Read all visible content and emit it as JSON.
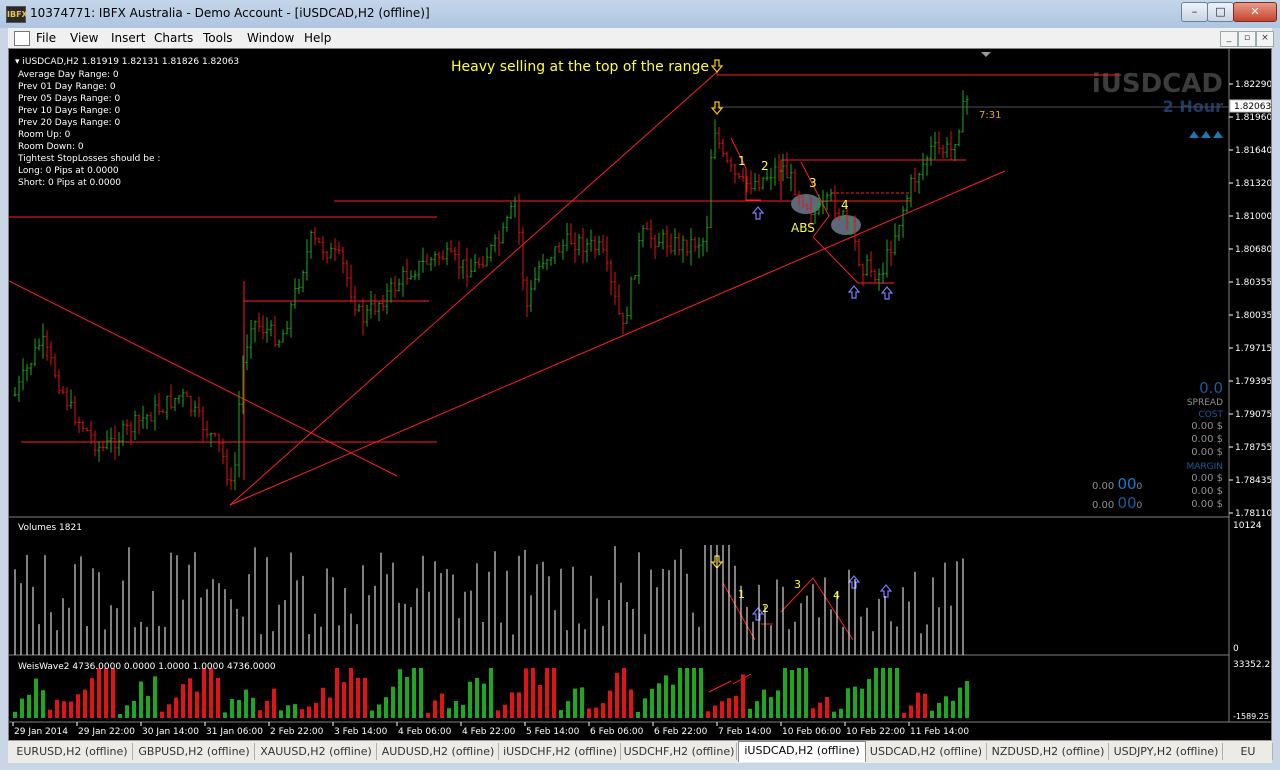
{
  "window": {
    "title": "10374771: IBFX Australia - Demo Account - [iUSDCAD,H2 (offline)]",
    "app_icon_text": "IBFX",
    "min_label": "–",
    "max_label": "□",
    "close_label": "✕"
  },
  "menu": [
    "File",
    "View",
    "Insert",
    "Charts",
    "Tools",
    "Window",
    "Help"
  ],
  "chart": {
    "header": "iUSDCAD,H2  1.81919 1.82131 1.81826 1.82063",
    "info_lines": [
      "Average Day  Range: 0",
      "Prev 01  Day  Range: 0",
      "Prev 05  Days Range: 0",
      "Prev 10  Days Range: 0",
      "Prev 20  Days Range: 0",
      "Room Up:      0",
      "Room Down: 0",
      "Tightest StopLosses should be :",
      "Long:  0 Pips at 0.0000",
      "Short: 0 Pips at 0.0000"
    ],
    "annotation_title": "Heavy selling at the top of the range",
    "watermark_symbol": "iUSDCAD",
    "watermark_period": "2 Hour",
    "countdown": "7:31",
    "price_tag": "1.82063",
    "abs_label": "ABS",
    "wave_labels": [
      "1",
      "2",
      "3",
      "4"
    ],
    "price_axis": [
      "1.82290",
      "1.81960",
      "1.81640",
      "1.81320",
      "1.81000",
      "1.80680",
      "1.80355",
      "1.80035",
      "1.79715",
      "1.79395",
      "1.79075",
      "1.78755",
      "1.78435",
      "1.78110"
    ],
    "side_panel": {
      "spread_value": "0.0",
      "spread_label": "SPREAD",
      "cost_label": "COST",
      "cost_values": [
        "0.00 $",
        "0.00 $",
        "0.00 $"
      ],
      "margin_label": "MARGIN",
      "margin_values": [
        "0.00 $",
        "0.00 $",
        "0.00 $"
      ],
      "lot_row1_small": "0.00",
      "lot_row1_big": "00",
      "lot_row1_tiny": "0",
      "lot_row2_small": "0.00",
      "lot_row2_big": "00",
      "lot_row2_tiny": "0"
    },
    "time_axis": [
      "29 Jan 2014",
      "29 Jan 22:00",
      "30 Jan 14:00",
      "31 Jan 06:00",
      "2 Feb 22:00",
      "3 Feb 14:00",
      "4 Feb 06:00",
      "4 Feb 22:00",
      "5 Feb 14:00",
      "6 Feb 06:00",
      "6 Feb 22:00",
      "7 Feb 14:00",
      "10 Feb 06:00",
      "10 Feb 22:00",
      "11 Feb 14:00"
    ]
  },
  "volumes": {
    "header": "Volumes 1821",
    "axis_top": "10124",
    "axis_bottom": "0",
    "wave_labels": [
      "1",
      "2",
      "3",
      "4"
    ]
  },
  "weis": {
    "header": "WeisWave2 4736.0000 0.0000 1.0000 1.0000 4736.0000",
    "axis_top": "33352.25",
    "axis_bottom": "-1589.25"
  },
  "tabs": [
    {
      "label": "EURUSD,H2 (offline)",
      "active": false
    },
    {
      "label": "GBPUSD,H2 (offline)",
      "active": false
    },
    {
      "label": "XAUUSD,H2 (offline)",
      "active": false
    },
    {
      "label": "AUDUSD,H2 (offline)",
      "active": false
    },
    {
      "label": "iUSDCHF,H2 (offline)",
      "active": false
    },
    {
      "label": "USDCHF,H2 (offline)",
      "active": false
    },
    {
      "label": "iUSDCAD,H2 (offline)",
      "active": true
    },
    {
      "label": "USDCAD,H2 (offline)",
      "active": false
    },
    {
      "label": "NZDUSD,H2 (offline)",
      "active": false
    },
    {
      "label": "USDJPY,H2 (offline)",
      "active": false
    },
    {
      "label": "EU",
      "active": false
    }
  ],
  "colors": {
    "bull": "#1fa81f",
    "bear": "#e01414",
    "line_red": "#ff2020",
    "annotation_yellow": "#ffff33",
    "arrow_blue": "#7a7aff",
    "watermark": "#3c3c3c"
  }
}
